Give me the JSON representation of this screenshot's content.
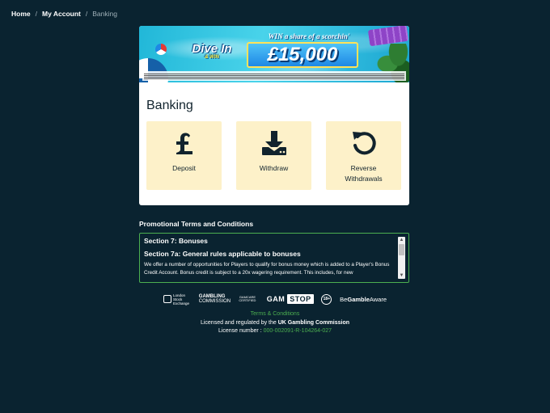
{
  "breadcrumb": {
    "home": "Home",
    "separator": "/",
    "my_account": "My Account",
    "current": "Banking"
  },
  "banner": {
    "logo_big": "Dive In",
    "logo_small": "& WIN",
    "tagline": "WIN a share of a scorchin'",
    "prize": "£15,000"
  },
  "banking": {
    "title": "Banking",
    "tiles": [
      {
        "label": "Deposit",
        "icon": "pound-icon"
      },
      {
        "label": "Withdraw",
        "icon": "download-icon"
      },
      {
        "label": "Reverse Withdrawals",
        "icon": "undo-icon"
      }
    ]
  },
  "promo": {
    "heading": "Promotional Terms and Conditions",
    "section1": "Section 7: Bonuses",
    "section2": "Section 7a: General rules applicable to bonuses",
    "body": "We offer a number of opportunities for Players to qualify for bonus money which is added to a Player's Bonus Credit Account. Bonus credit is subject to a 20x wagering requirement. This includes, for new"
  },
  "logos": {
    "lse": "London Stock Exchange",
    "gc_line1": "GAMBLING",
    "gc_line2": "COMMISSION",
    "gcc": "GAMCARE CERTIFIED",
    "gamstop_a": "GAM",
    "gamstop_b": "STOP",
    "age": "18+",
    "bga_prefix": "Be",
    "bga_mid": "Gamble",
    "bga_suffix": "Aware"
  },
  "footer": {
    "terms": "Terms & Conditions",
    "licensed_prefix": "Licensed and regulated by the",
    "regulator": "UK Gambling Commission",
    "license_prefix": "License number :",
    "license_number": "000-002091-R-104264-027"
  },
  "colors": {
    "background": "#0a2330",
    "tile": "#fdf1c9",
    "accent_green": "#4caf50"
  }
}
